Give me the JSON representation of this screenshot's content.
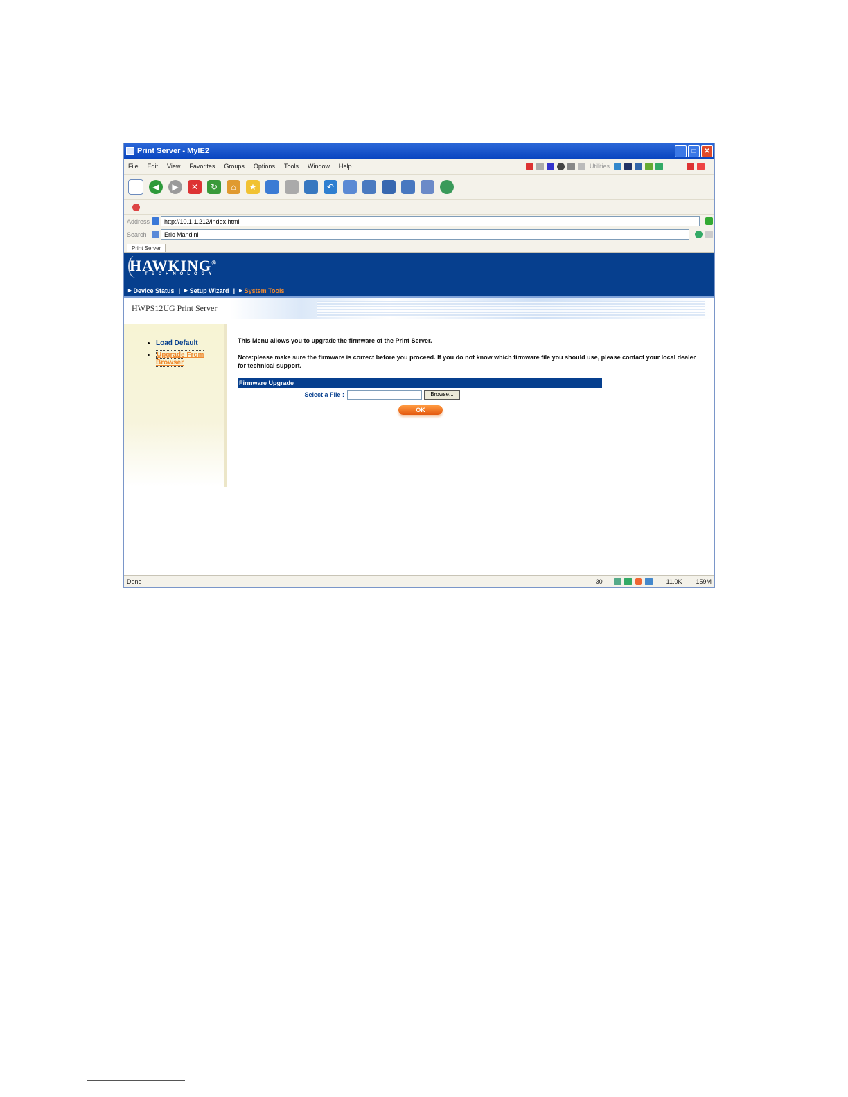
{
  "window": {
    "title": "Print Server - MyIE2",
    "min": "_",
    "max": "□",
    "close": "✕"
  },
  "menu": [
    "File",
    "Edit",
    "View",
    "Favorites",
    "Groups",
    "Options",
    "Tools",
    "Window",
    "Help"
  ],
  "menu_extra": "Utilities",
  "address": {
    "label": "Address",
    "value": "http://10.1.1.212/index.html"
  },
  "search": {
    "label": "Search",
    "value": "Eric Mandini"
  },
  "tab": "Print Server",
  "brand": {
    "name": "HAWKING",
    "reg": "®",
    "sub": "TECHNOLOGY"
  },
  "nav": [
    {
      "label": "Device Status",
      "active": false
    },
    {
      "label": "Setup Wizard",
      "active": false
    },
    {
      "label": "System Tools",
      "active": true
    }
  ],
  "nav_sep": "|",
  "page_title": "HWPS12UG Print Server",
  "sidebar": [
    {
      "label": "Load Default",
      "current": false
    },
    {
      "label": "Upgrade From Browser",
      "current": true
    }
  ],
  "main": {
    "intro": "This Menu allows you to upgrade the firmware of the Print Server.",
    "note": "Note:please make sure the firmware is correct before you proceed. If you do not know which firmware file you should use, please contact your local dealer for technical support.",
    "panel_title": "Firmware Upgrade",
    "select_label": "Select a File :",
    "browse": "Browse...",
    "ok": "OK"
  },
  "status": {
    "left": "Done",
    "count": "30",
    "size": "11.0K",
    "mem": "159M"
  }
}
